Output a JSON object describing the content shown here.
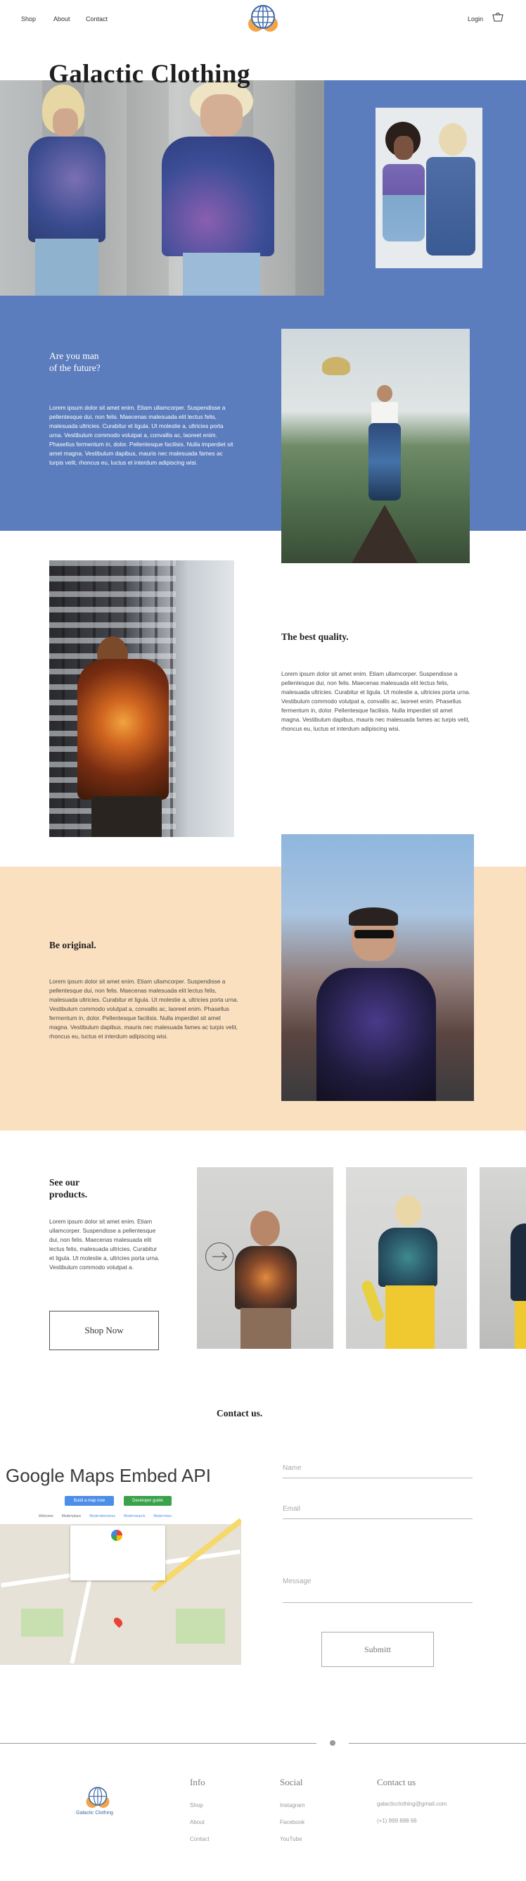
{
  "nav": {
    "links": [
      "Shop",
      "About",
      "Contact"
    ],
    "login": "Login"
  },
  "hero": {
    "title": "Galactic Clothing"
  },
  "section_man": {
    "heading": "Are you man\nof the future?",
    "text": "Lorem ipsum dolor sit amet enim. Etiam ullamcorper. Suspendisse a pellentesque dui, non felis. Maecenas malesuada elit lectus felis, malesuada ultricies. Curabitur et ligula. Ut molestie a, ultricies porta urna. Vestibulum commodo volutpat a, convallis ac, laoreet enim. Phasellus fermentum in, dolor. Pellentesque facilisis. Nulla imperdiet sit amet magna. Vestibulum dapibus, mauris nec malesuada fames ac turpis velit, rhoncus eu, luctus et interdum adipiscing wisi."
  },
  "section_quality": {
    "heading": "The best quality.",
    "text": "Lorem ipsum dolor sit amet enim. Etiam ullamcorper. Suspendisse a pellentesque dui, non felis. Maecenas malesuada elit lectus felis, malesuada ultricies. Curabitur et ligula. Ut molestie a, ultricies porta urna. Vestibulum commodo volutpat a, convallis ac, laoreet enim. Phasellus fermentum in, dolor. Pellentesque facilisis. Nulla imperdiet sit amet magna. Vestibulum dapibus, mauris nec malesuada fames ac turpis velit, rhoncus eu, luctus et interdum adipiscing wisi."
  },
  "section_original": {
    "heading": "Be original.",
    "text": "Lorem ipsum dolor sit amet enim. Etiam ullamcorper. Suspendisse a pellentesque dui, non felis. Maecenas malesuada elit lectus felis, malesuada ultricies. Curabitur et ligula. Ut molestie a, ultricies porta urna. Vestibulum commodo volutpat a, convallis ac, laoreet enim. Phasellus fermentum in, dolor. Pellentesque facilisis. Nulla imperdiet sit amet magna. Vestibulum dapibus, mauris nec malesuada fames ac turpis velit, rhoncus eu, luctus et interdum adipiscing wisi."
  },
  "products": {
    "heading": "See our\nproducts.",
    "text": "Lorem ipsum dolor sit amet enim. Etiam ullamcorper. Suspendisse a pellentesque dui, non felis. Maecenas malesuada elit lectus felis, malesuada ultricies. Curabitur et ligula. Ut molestie a, ultricies porta urna. Vestibulum commodo volutpat a.",
    "shop_now": "Shop Now"
  },
  "contact": {
    "heading": "Contact us.",
    "map_title": "Google Maps Embed API",
    "map_btn1": "Build a map now",
    "map_btn2": "Developer guide",
    "map_tabs": [
      "Welcome",
      "Mode=place",
      "Mode=directions",
      "Mode=search",
      "Mode=view"
    ],
    "name_placeholder": "Name",
    "email_placeholder": "Email",
    "message_placeholder": "Message",
    "submit": "Submitt"
  },
  "footer": {
    "brand": "Galactic Clothing",
    "info_title": "Info",
    "info_links": [
      "Shop",
      "About",
      "Contact"
    ],
    "social_title": "Social",
    "social_links": [
      "Instagram",
      "Facebook",
      "YouTube"
    ],
    "contact_title": "Contact us",
    "email": "galacticclothing@gmail.com",
    "phone": "(+1) 999 888 66"
  },
  "colors": {
    "blue": "#5b7cbd",
    "peach": "#fbe0c0",
    "logo_orange": "#f0a24a",
    "logo_blue": "#3d6aa9"
  }
}
